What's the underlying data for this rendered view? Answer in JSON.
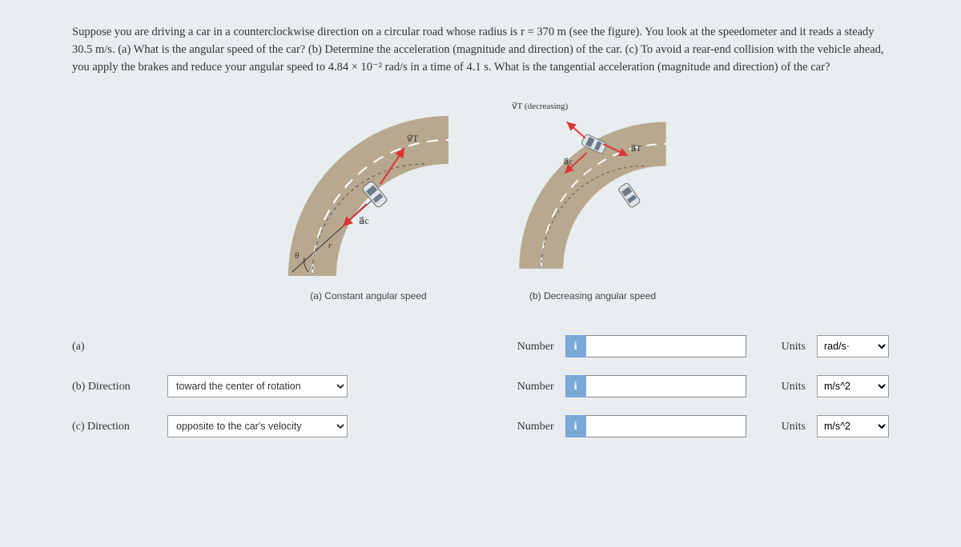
{
  "problem": {
    "text": "Suppose you are driving a car in a counterclockwise direction on a circular road whose radius is r = 370 m (see the figure). You look at the speedometer and it reads a steady 30.5 m/s. (a) What is the angular speed of the car? (b) Determine the acceleration (magnitude and direction) of the car. (c) To avoid a rear-end collision with the vehicle ahead, you apply the brakes and reduce your angular speed to 4.84 × 10⁻² rad/s in a time of 4.1 s. What is the tangential acceleration (magnitude and direction) of the car?"
  },
  "figure": {
    "panel_a": {
      "caption": "(a) Constant angular speed",
      "vt_label": "v⃗T",
      "ac_label": "a⃗c",
      "theta_label": "θ",
      "r_label": "r"
    },
    "panel_b": {
      "caption": "(b) Decreasing angular speed",
      "vt_label": "v⃗T (decreasing)",
      "ac_label": "a⃗c",
      "at_label": "a⃗T"
    }
  },
  "answers": {
    "a": {
      "part": "(a)",
      "number_label": "Number",
      "number_value": "",
      "units_label": "Units",
      "units_value": "rad/s·"
    },
    "b": {
      "part": "(b)   Direction",
      "direction_value": "toward the center of rotation",
      "number_label": "Number",
      "number_value": "",
      "units_label": "Units",
      "units_value": "m/s^2"
    },
    "c": {
      "part": "(c)   Direction",
      "direction_value": "opposite to the car's velocity",
      "number_label": "Number",
      "number_value": "",
      "units_label": "Units",
      "units_value": "m/s^2"
    }
  },
  "info_icon": "i"
}
